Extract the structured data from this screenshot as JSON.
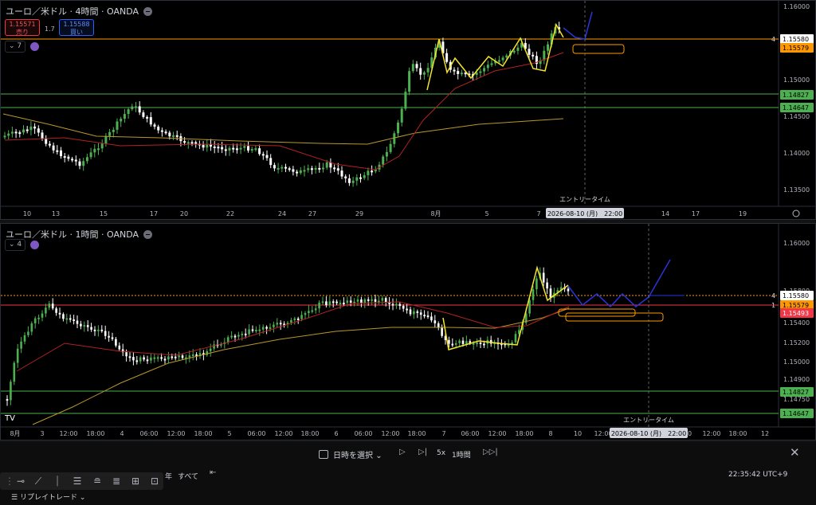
{
  "colors": {
    "up": "#4caf50",
    "down": "#ffffff",
    "ma_fast": "#b22222",
    "ma_slow": "#b9972c",
    "zigzag": "#f5e52a",
    "projection": "#2a35d8",
    "hline_green": "#4caf50",
    "hline_orange": "#ff9800",
    "hline_red": "#f23645",
    "zone": "#ff9800",
    "axis_text": "#b2b5be"
  },
  "panel4h": {
    "title": "ユーロ／米ドル · 4時間 · OANDA",
    "sell": {
      "price": "1.15571",
      "label": "売り"
    },
    "buy": {
      "price": "1.15588",
      "label": "買い"
    },
    "spread": "1.7",
    "indicators_count": "7",
    "price_axis": [
      "1.16000",
      "1.15500",
      "1.15000",
      "1.14500",
      "1.14000",
      "1.13500"
    ],
    "price_tags": [
      {
        "text": "1.15580",
        "style": "white"
      },
      {
        "text": "1.15579",
        "style": "orange"
      },
      {
        "text": "1.14827",
        "style": "green"
      },
      {
        "text": "1.14647",
        "style": "green"
      }
    ],
    "tag_counter": "4",
    "time_axis": [
      "10",
      "13",
      "15",
      "17",
      "20",
      "22",
      "24",
      "27",
      "29",
      "8月",
      "5",
      "7",
      "14",
      "17",
      "19"
    ],
    "entry_label": "エントリータイム",
    "entry_time": "2026-08-10 (月)　22:00"
  },
  "panel1h": {
    "title": "ユーロ／米ドル · 1時間 · OANDA",
    "indicators_count": "4",
    "price_axis": [
      "1.16000",
      "1.15800",
      "1.15400",
      "1.15200",
      "1.15000",
      "1.14900",
      "1.14750"
    ],
    "price_tags": [
      {
        "text": "1.15580",
        "style": "white"
      },
      {
        "text": "1.15579",
        "style": "orange"
      },
      {
        "text": "1.15493",
        "style": "red"
      },
      {
        "text": "1.14827",
        "style": "green"
      },
      {
        "text": "1.14647",
        "style": "green"
      }
    ],
    "tag_counters": [
      "4",
      "1"
    ],
    "time_axis": [
      "8月",
      "3",
      "12:00",
      "18:00",
      "4",
      "06:00",
      "12:00",
      "18:00",
      "5",
      "06:00",
      "12:00",
      "18:00",
      "6",
      "06:00",
      "12:00",
      "18:00",
      "7",
      "06:00",
      "12:00",
      "18:00",
      "8",
      "10",
      "12:00",
      "18:00",
      "00",
      "12:00",
      "18:00",
      "12"
    ],
    "entry_label": "エントリータイム",
    "entry_time": "2026-08-10 (月)　22:00"
  },
  "toolbar": {
    "date_select": "日時を選択",
    "speed": "5x",
    "interval": "1時間",
    "year": "年",
    "all": "すべて",
    "clock": "22:35:42 UTC+9",
    "replay": "リプレイトレード"
  }
}
